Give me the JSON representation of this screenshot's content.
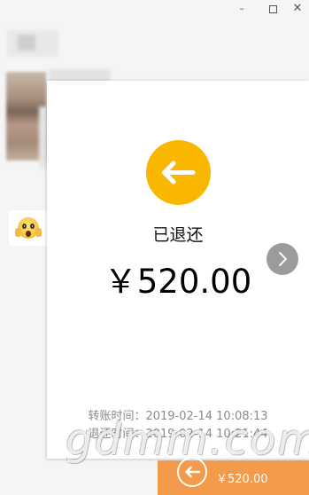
{
  "window": {
    "minimize_glyph": "–",
    "close_glyph": "✕"
  },
  "transfer": {
    "status": "已退还",
    "amount": "￥520.00",
    "transfer_time": "转账时间：2019-02-14 10:08:13",
    "refund_time": "退还时间：2019-02-14 10:21:44"
  },
  "bottom_bar": {
    "amount": "￥520.00"
  },
  "watermark": "gdmm.com",
  "colors": {
    "status_icon": "#f9b700",
    "bottom_bar": "#f39a4b",
    "next_button": "#9b9b9b"
  },
  "icons": {
    "status": "arrow-left-icon",
    "next": "chevron-right-icon",
    "emoji": "screaming-face-emoji"
  }
}
